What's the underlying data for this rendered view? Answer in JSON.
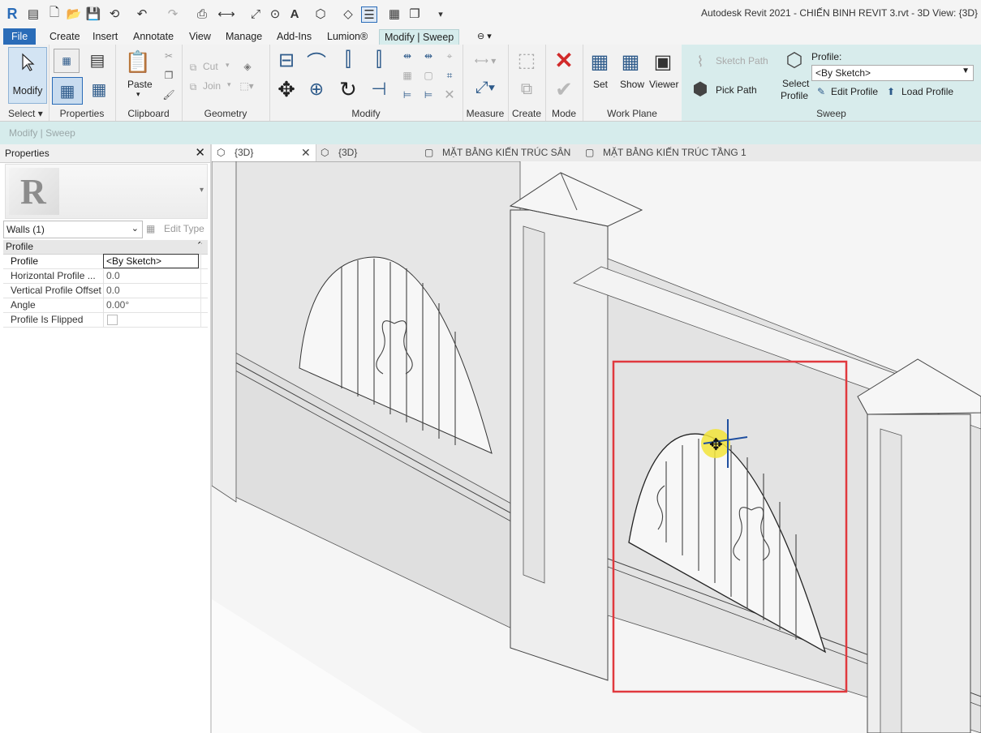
{
  "app": {
    "title": "Autodesk Revit 2021 - CHIẾN BINH REVIT 3.rvt - 3D View: {3D}"
  },
  "ribbon_tabs": [
    "File",
    "Create",
    "Insert",
    "Annotate",
    "View",
    "Manage",
    "Add-Ins",
    "Lumion®",
    "Modify | Sweep"
  ],
  "ribbon": {
    "modify_label": "Modify",
    "select_panel": "Select",
    "properties_panel": "Properties",
    "clipboard_panel": "Clipboard",
    "paste_label": "Paste",
    "geometry_panel": "Geometry",
    "cut_label": "Cut",
    "join_label": "Join",
    "modify_panel": "Modify",
    "measure_panel": "Measure",
    "create_panel": "Create",
    "mode_panel": "Mode",
    "workplane_panel": "Work Plane",
    "set_label": "Set",
    "show_label": "Show",
    "viewer_label": "Viewer",
    "sketch_path_label": "Sketch Path",
    "pick_path_label": "Pick Path",
    "select_profile_label1": "Select",
    "select_profile_label2": "Profile",
    "profile_label": "Profile:",
    "profile_value": "<By Sketch>",
    "edit_profile_label": "Edit Profile",
    "load_profile_label": "Load Profile",
    "sweep_panel": "Sweep"
  },
  "optionbar": {
    "context": "Modify | Sweep"
  },
  "properties": {
    "title": "Properties",
    "type_selector": "Walls (1)",
    "edit_type": "Edit Type",
    "group": "Profile",
    "rows": [
      {
        "key": "Profile",
        "value": "<By Sketch>"
      },
      {
        "key": "Horizontal Profile ...",
        "value": "0.0"
      },
      {
        "key": "Vertical Profile Offset",
        "value": "0.0"
      },
      {
        "key": "Angle",
        "value": "0.00°"
      },
      {
        "key": "Profile Is Flipped",
        "value": ""
      }
    ]
  },
  "view_tabs": [
    {
      "label": "{3D}",
      "active": true
    },
    {
      "label": "{3D}",
      "active": false
    },
    {
      "label": "MẶT BẰNG KIẾN TRÚC SÂN",
      "active": false
    },
    {
      "label": "MẶT BẰNG KIẾN TRÚC TẦNG 1",
      "active": false
    }
  ],
  "colors": {
    "file_tab": "#2a6cb8",
    "context_tab": "#d6ecec",
    "highlight_box": "#e0393e",
    "cursor_glow": "#f2e43a"
  }
}
